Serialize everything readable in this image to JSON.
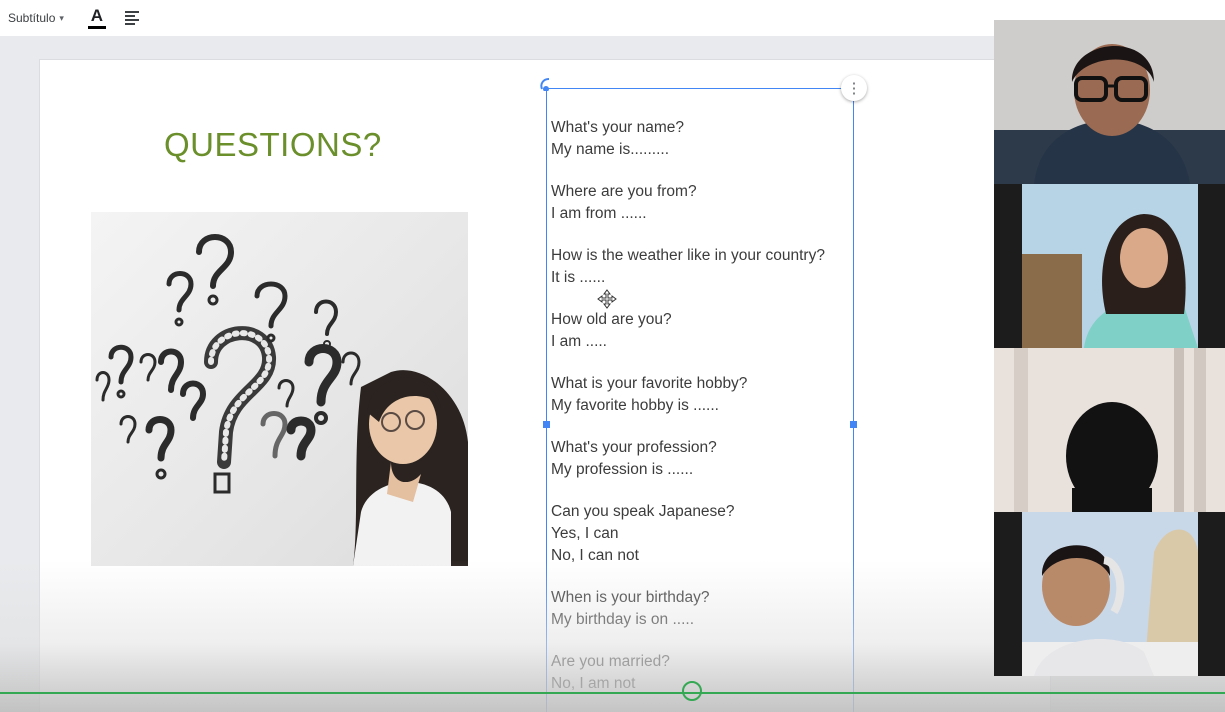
{
  "toolbar": {
    "paragraph_style": "Subtítulo",
    "paragraph_style_caret": "▾",
    "text_color_letter": "A"
  },
  "slide": {
    "title": "QUESTIONS?",
    "title_color": "#6a8f2b",
    "qa": [
      {
        "q": " What's your name?",
        "a": [
          "My name is........."
        ]
      },
      {
        "q": " Where are you from?",
        "a": [
          "I am from ......"
        ]
      },
      {
        "q": " How is the weather like in your country?",
        "a": [
          "It is ......"
        ]
      },
      {
        "q": "How old are you?",
        "a": [
          "I am ....."
        ]
      },
      {
        "q": " What is your favorite hobby?",
        "a": [
          "My favorite hobby is ......"
        ]
      },
      {
        "q": " What's your profession?",
        "a": [
          "My profession is ......"
        ]
      },
      {
        "q": "Can you speak Japanese?",
        "a": [
          "Yes, I can",
          "No, I can not"
        ]
      },
      {
        "q": "When is your birthday?",
        "a": [
          "My birthday is on ....."
        ]
      },
      {
        "q": "Are you married?",
        "a": [
          "No, I am not"
        ]
      }
    ]
  },
  "selection": {
    "color": "#4285f4",
    "more_icon": "⋮"
  },
  "video_progress": {
    "color": "#34a853"
  },
  "participants": [
    {
      "name_icon": "participant-video-1"
    },
    {
      "name_icon": "participant-video-2"
    },
    {
      "name_icon": "participant-video-3"
    },
    {
      "name_icon": "participant-video-4"
    }
  ]
}
